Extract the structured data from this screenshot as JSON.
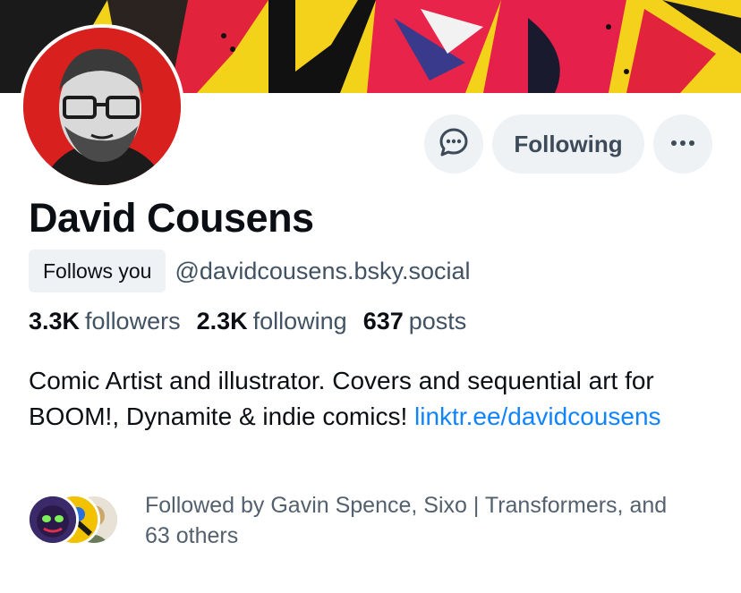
{
  "profile": {
    "display_name": "David Cousens",
    "follows_you_badge": "Follows you",
    "handle": "@davidcousens.bsky.social",
    "avatar_icon": "profile-portrait-avatar"
  },
  "actions": {
    "message_icon": "message-bubble-icon",
    "following_label": "Following",
    "more_icon": "ellipsis-icon"
  },
  "stats": {
    "followers_count": "3.3K",
    "followers_label": "followers",
    "following_count": "2.3K",
    "following_label": "following",
    "posts_count": "637",
    "posts_label": "posts"
  },
  "bio": {
    "text": "Comic Artist and illustrator. Covers and sequential art for BOOM!, Dynamite & indie comics! ",
    "link_text": "linktr.ee/​davidcousens"
  },
  "followed_by": {
    "text": "Followed by Gavin Spence, Sixo | Transformers, and 63 others"
  },
  "colors": {
    "accent_link": "#1083fe",
    "button_bg": "#eef2f5",
    "muted_text": "#415263",
    "avatar_bg": "#d8211f",
    "banner_yellow": "#f2d21a"
  }
}
